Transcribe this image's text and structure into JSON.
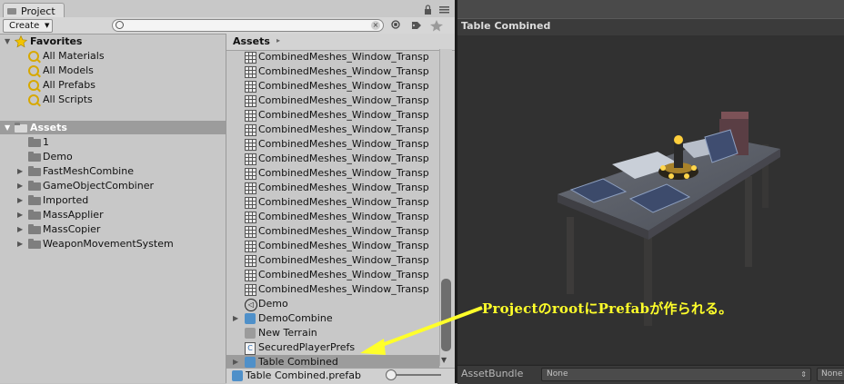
{
  "window": {
    "tab_title": "Project",
    "create_label": "Create"
  },
  "favorites": {
    "title": "Favorites",
    "items": [
      "All Materials",
      "All Models",
      "All Prefabs",
      "All Scripts"
    ]
  },
  "assets_tree": {
    "title": "Assets",
    "folders": [
      {
        "label": "1",
        "expandable": false
      },
      {
        "label": "Demo",
        "expandable": false
      },
      {
        "label": "FastMeshCombine",
        "expandable": true
      },
      {
        "label": "GameObjectCombiner",
        "expandable": true
      },
      {
        "label": "Imported",
        "expandable": true
      },
      {
        "label": "MassApplier",
        "expandable": true
      },
      {
        "label": "MassCopier",
        "expandable": true
      },
      {
        "label": "WeaponMovementSystem",
        "expandable": true
      }
    ]
  },
  "asset_list": {
    "breadcrumb": "Assets",
    "mesh_item_label": "CombinedMeshes_Window_Transp",
    "mesh_item_count": 17,
    "items": [
      {
        "label": "Demo",
        "icon": "unity-scene-icon"
      },
      {
        "label": "DemoCombine",
        "icon": "prefab-icon",
        "expandable": true
      },
      {
        "label": "New Terrain",
        "icon": "terrain-icon"
      },
      {
        "label": "SecuredPlayerPrefs",
        "icon": "csharp-script-icon"
      },
      {
        "label": "Table Combined",
        "icon": "prefab-icon",
        "expandable": true,
        "selected": true
      }
    ],
    "status_path": "Table Combined.prefab"
  },
  "preview": {
    "title": "Table Combined",
    "asset_bundle_label": "AssetBundle",
    "asset_bundle_value": "None",
    "asset_bundle_variant": "None"
  },
  "annotation": {
    "text": "ProjectのrootにPrefabが作られる。",
    "color": "#ffff2a"
  },
  "colors": {
    "selection": "#9c9c9c",
    "prefab_blue": "#4f90c9"
  }
}
